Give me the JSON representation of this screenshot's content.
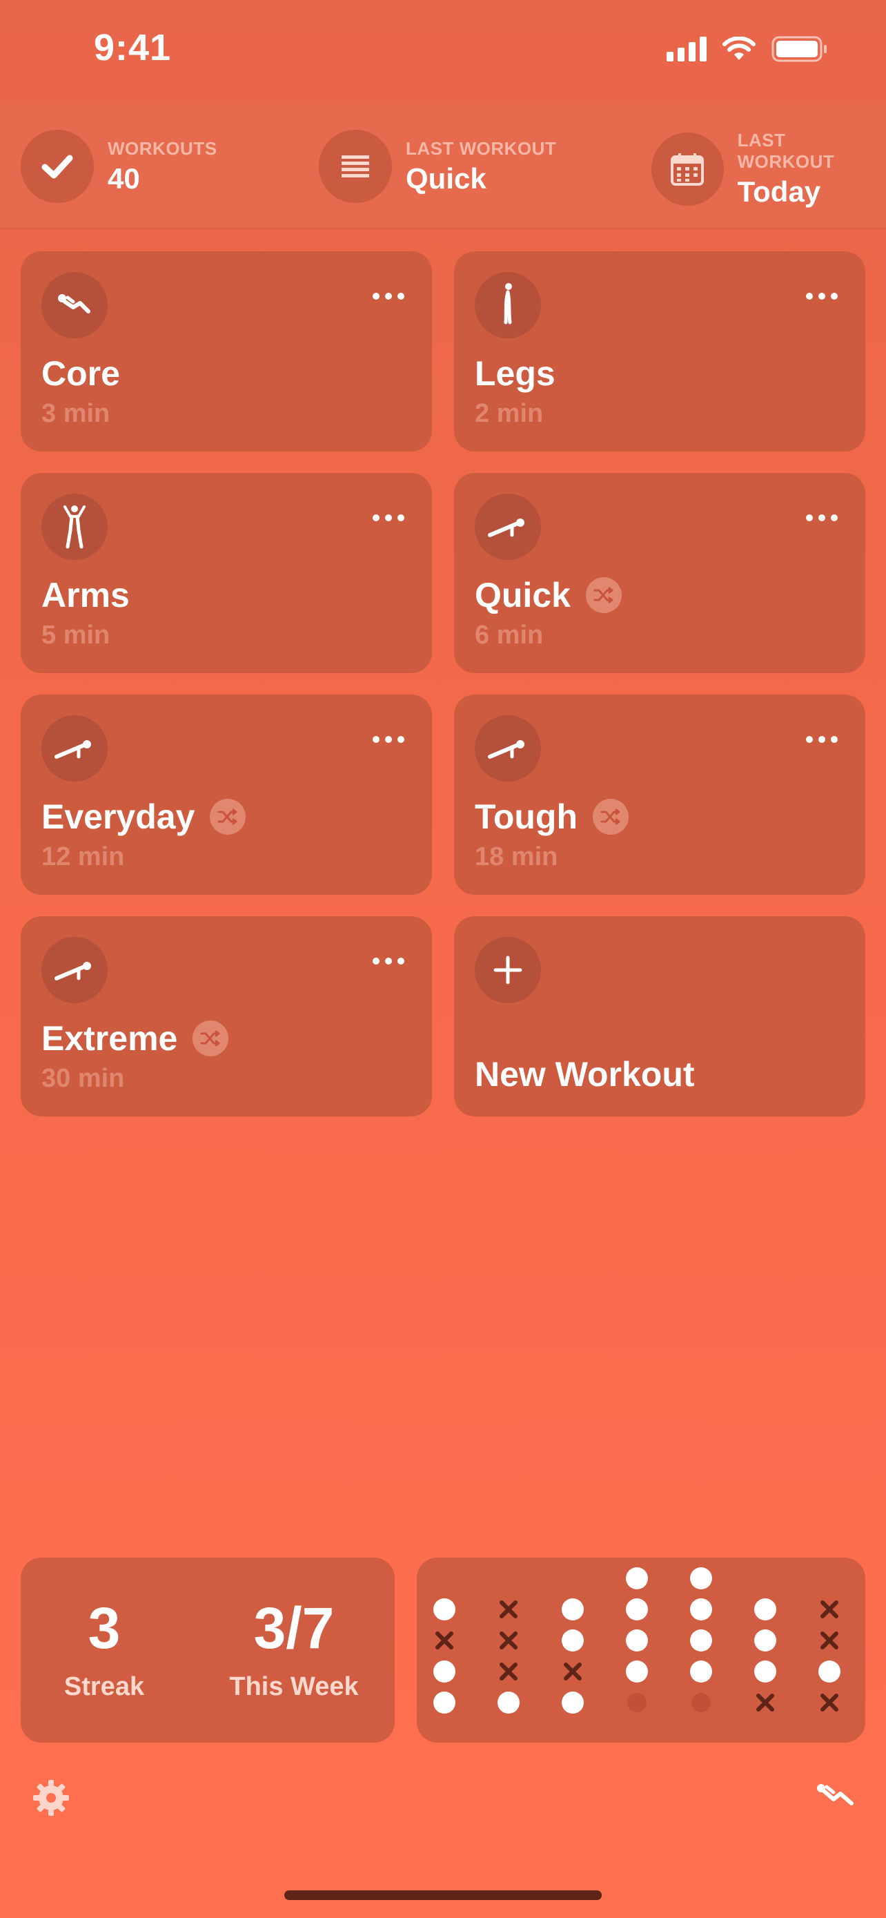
{
  "status_bar": {
    "time": "9:41"
  },
  "header": {
    "stats": [
      {
        "label": "WORKOUTS",
        "value": "40",
        "icon": "checkmark-icon"
      },
      {
        "label": "LAST WORKOUT",
        "value": "Quick",
        "icon": "list-icon"
      },
      {
        "label": "LAST WORKOUT",
        "value": "Today",
        "icon": "calendar-icon"
      }
    ]
  },
  "workouts": [
    {
      "title": "Core",
      "duration": "3 min",
      "icon": "situp-icon",
      "shuffle": false
    },
    {
      "title": "Legs",
      "duration": "2 min",
      "icon": "standing-figure-icon",
      "shuffle": false
    },
    {
      "title": "Arms",
      "duration": "5 min",
      "icon": "jumping-jack-icon",
      "shuffle": false
    },
    {
      "title": "Quick",
      "duration": "6 min",
      "icon": "pushup-icon",
      "shuffle": true
    },
    {
      "title": "Everyday",
      "duration": "12 min",
      "icon": "pushup-icon",
      "shuffle": true
    },
    {
      "title": "Tough",
      "duration": "18 min",
      "icon": "pushup-icon",
      "shuffle": true
    },
    {
      "title": "Extreme",
      "duration": "30 min",
      "icon": "pushup-icon",
      "shuffle": true
    }
  ],
  "new_workout": {
    "title": "New Workout",
    "icon": "plus-icon"
  },
  "summary": {
    "streak": {
      "value": "3",
      "label": "Streak"
    },
    "week": {
      "value": "3/7",
      "label": "This Week"
    }
  },
  "history": {
    "columns": [
      [
        "done",
        "missed",
        "done",
        "done"
      ],
      [
        "missed",
        "missed",
        "missed",
        "done"
      ],
      [
        "done",
        "done",
        "missed",
        "done"
      ],
      [
        "done",
        "done",
        "done",
        "done",
        "empty"
      ],
      [
        "done",
        "done",
        "done",
        "done",
        "empty"
      ],
      [
        "done",
        "done",
        "done",
        "missed"
      ],
      [
        "missed",
        "missed",
        "done",
        "missed"
      ]
    ]
  },
  "colors": {
    "accent": "#FF7050",
    "card": "#CC5B40",
    "missed": "#5E2416"
  }
}
